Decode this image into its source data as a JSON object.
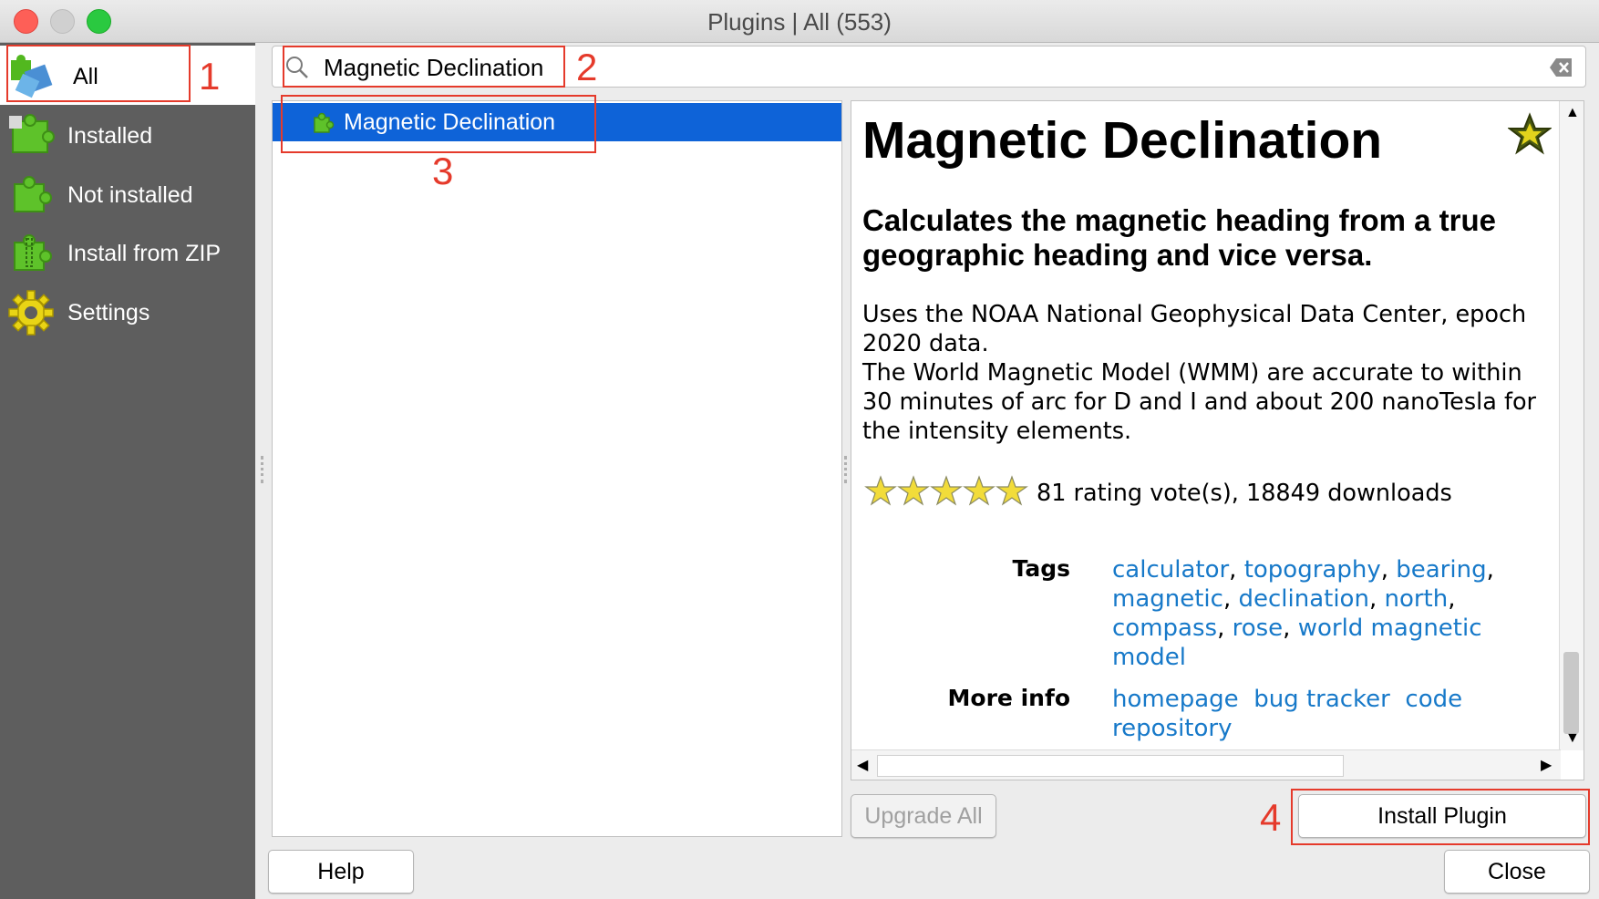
{
  "window": {
    "title": "Plugins | All (553)"
  },
  "sidebar": {
    "items": [
      {
        "label": "All",
        "icon": "plugins-all-icon"
      },
      {
        "label": "Installed",
        "icon": "plugin-installed-icon"
      },
      {
        "label": "Not installed",
        "icon": "plugin-not-installed-icon"
      },
      {
        "label": "Install from ZIP",
        "icon": "plugin-zip-icon"
      },
      {
        "label": "Settings",
        "icon": "settings-gear-icon"
      }
    ]
  },
  "search": {
    "value": "Magnetic Declination"
  },
  "plugin_list": {
    "items": [
      {
        "label": "Magnetic Declination",
        "selected": true
      }
    ]
  },
  "details": {
    "title": "Magnetic Declination",
    "summary": "Calculates the magnetic heading from a true geographic heading and vice versa.",
    "description_lines": [
      "Uses the NOAA National Geophysical Data Center, epoch 2020 data.",
      "The World Magnetic Model (WMM) are accurate to within 30 minutes of arc for D and I and about 200 nanoTesla for the intensity elements."
    ],
    "rating": {
      "stars": 5,
      "text": "81 rating vote(s), 18849 downloads"
    },
    "tags_label": "Tags",
    "tags": [
      "calculator",
      "topography",
      "bearing",
      "magnetic",
      "declination",
      "north",
      "compass",
      "rose",
      "world magnetic model"
    ],
    "more_info_label": "More info",
    "more_info_links": [
      "homepage",
      "bug tracker",
      "code repository"
    ]
  },
  "buttons": {
    "upgrade_all": "Upgrade All",
    "install_plugin": "Install Plugin",
    "help": "Help",
    "close": "Close"
  },
  "annotations": [
    "1",
    "2",
    "3",
    "4"
  ],
  "colors": {
    "selection": "#0e63d8",
    "sidebar": "#5e5e5e",
    "link": "#1779c9",
    "annotation": "#e53a2b"
  }
}
